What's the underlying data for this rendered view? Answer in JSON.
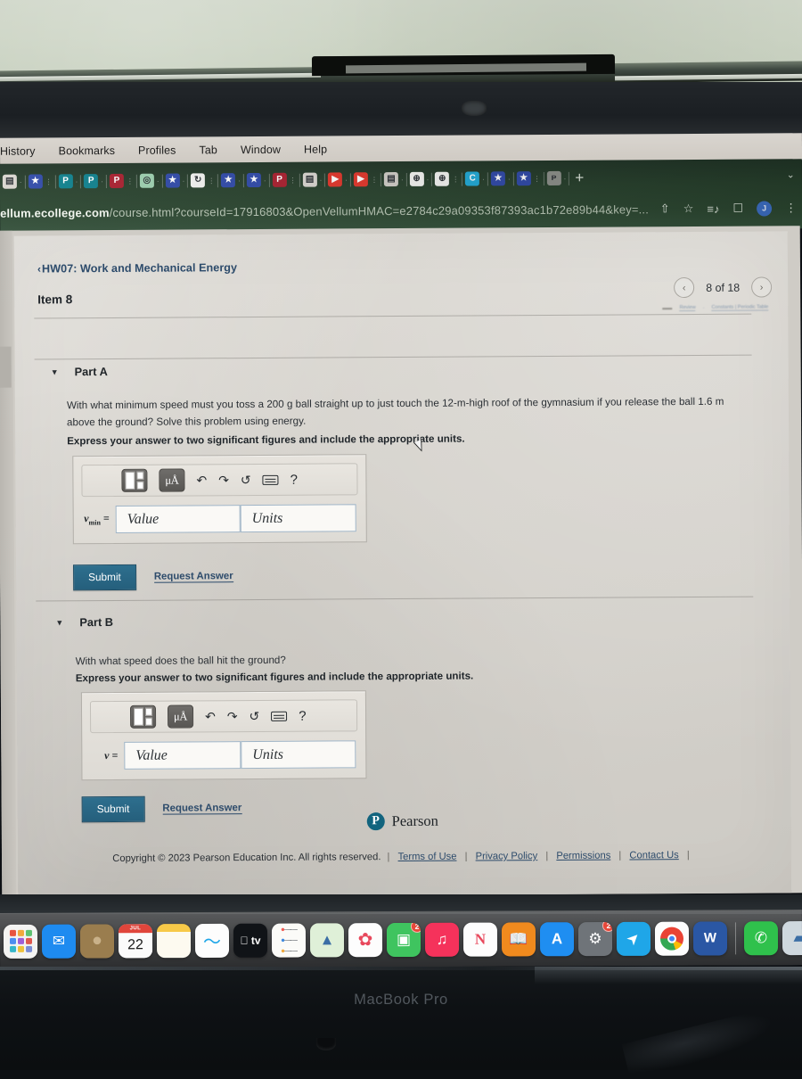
{
  "photo": {
    "device_label": "MacBook Pro"
  },
  "menubar": {
    "items": [
      "History",
      "Bookmarks",
      "Profiles",
      "Tab",
      "Window",
      "Help"
    ]
  },
  "browser": {
    "url_bold": "ellum.ecollege.com",
    "url_rest": "/course.html?courseId=17916803&OpenVellumHMAC=e2784c29a09353f87393ac1b72e89b44&key=...",
    "new_tab_label": "+",
    "tab_list_chevron": "⌄",
    "omnibox_icons": [
      "share-icon",
      "bookmark-star-icon",
      "reading-list-icon",
      "side-panel-icon"
    ],
    "profile_initial": "J",
    "menu_dots": "⋮",
    "tabs": [
      {
        "favicon": "book-icon",
        "color": "#d8d5cf",
        "glyph": "▤"
      },
      {
        "favicon": "star-icon",
        "color": "#2f49a8",
        "glyph": "★"
      },
      {
        "favicon": "pearson-icon",
        "color": "#0d7f8c",
        "glyph": "P"
      },
      {
        "favicon": "pearson-icon",
        "color": "#0d7f8c",
        "glyph": "P"
      },
      {
        "favicon": "pinterest-icon",
        "color": "#a81f2e",
        "glyph": "P"
      },
      {
        "favicon": "mint-app-icon",
        "color": "#9ccfae",
        "glyph": "◎"
      },
      {
        "favicon": "star-icon",
        "color": "#2f49a8",
        "glyph": "★"
      },
      {
        "favicon": "refresh-app-icon",
        "color": "#f2f2f0",
        "glyph": "↻"
      },
      {
        "favicon": "star-icon",
        "color": "#2f49a8",
        "glyph": "★"
      },
      {
        "favicon": "star-icon",
        "color": "#2f49a8",
        "glyph": "★"
      },
      {
        "favicon": "pinterest-icon",
        "color": "#a81f2e",
        "glyph": "P"
      },
      {
        "favicon": "book-icon",
        "color": "#d8d5cf",
        "glyph": "▤"
      },
      {
        "favicon": "youtube-icon",
        "color": "#e1352a",
        "glyph": "▶"
      },
      {
        "favicon": "youtube-icon",
        "color": "#e1352a",
        "glyph": "▶"
      },
      {
        "favicon": "book-icon",
        "color": "#cfccc6",
        "glyph": "▤"
      },
      {
        "favicon": "globe-icon",
        "color": "#f3f3f1",
        "glyph": "⊕"
      },
      {
        "favicon": "globe-icon",
        "color": "#f3f3f1",
        "glyph": "⊕"
      },
      {
        "favicon": "chegg-icon",
        "color": "#1fa9d6",
        "glyph": "C"
      },
      {
        "favicon": "star-icon",
        "color": "#2f49a8",
        "glyph": "★"
      },
      {
        "favicon": "star-icon",
        "color": "#2f49a8",
        "glyph": "★"
      },
      {
        "favicon": "apple-icon",
        "color": "#8c8f8a",
        "glyph": "ᴘ"
      }
    ]
  },
  "page": {
    "breadcrumb": "HW07: Work and Mechanical Energy",
    "breadcrumb_caret": "‹",
    "item_title": "Item 8",
    "pager": {
      "prev": "‹",
      "next": "›",
      "label": "8 of 18"
    },
    "mini_links": [
      "Review",
      "Constants | Periodic Table"
    ],
    "parts": [
      {
        "toggle": "▼",
        "label": "Part A",
        "question": "With what minimum speed must you toss a 200 g ball straight up to just touch the 12-m-high roof of the gymnasium if you release the ball 1.6 m above the ground? Solve this problem using energy.",
        "instruction": "Express your answer to two significant figures and include the appropriate units.",
        "answer": {
          "variable": "v",
          "subscript": "min",
          "equals": "=",
          "value_placeholder": "Value",
          "units_placeholder": "Units",
          "value": "",
          "units": ""
        },
        "toolbar": [
          {
            "name": "math-template-button",
            "label": ""
          },
          {
            "name": "units-button",
            "label": "μÅ"
          },
          {
            "name": "undo-icon",
            "label": "↶"
          },
          {
            "name": "redo-icon",
            "label": "↷"
          },
          {
            "name": "reset-icon",
            "label": "↺"
          },
          {
            "name": "keyboard-icon",
            "label": ""
          },
          {
            "name": "help-icon",
            "label": "?"
          }
        ],
        "submit_label": "Submit",
        "request_answer_label": "Request Answer"
      },
      {
        "toggle": "▼",
        "label": "Part B",
        "question": "With what speed does the ball hit the ground?",
        "instruction": "Express your answer to two significant figures and include the appropriate units.",
        "answer": {
          "variable": "v",
          "subscript": "",
          "equals": "=",
          "value_placeholder": "Value",
          "units_placeholder": "Units",
          "value": "",
          "units": ""
        },
        "submit_label": "Submit",
        "request_answer_label": "Request Answer"
      }
    ],
    "footer": {
      "logo_letter": "P",
      "brand": "Pearson",
      "copyright": "Copyright © 2023 Pearson Education Inc. All rights reserved.",
      "links": [
        "Terms of Use",
        "Privacy Policy",
        "Permissions",
        "Contact Us"
      ],
      "separator": "|"
    },
    "colors": {
      "link": "#2d4b6b",
      "submit_bg": "#2e6f8e",
      "field_border": "#9fb4c6",
      "pearson_blue": "#12647e"
    }
  },
  "dock": {
    "items": [
      {
        "name": "launchpad",
        "kind": "launchpad",
        "bg": "#f4f4f2",
        "running": false
      },
      {
        "name": "mail",
        "kind": "glyph",
        "glyph": "✉",
        "bg": "#1e8bf0",
        "running": false
      },
      {
        "name": "contacts",
        "kind": "glyph",
        "glyph": "●",
        "bg": "#9a7d4e",
        "running": false
      },
      {
        "name": "calendar",
        "kind": "calendar",
        "month": "JUL",
        "day": "22",
        "bg": "#fbfbfb",
        "running": false
      },
      {
        "name": "notes",
        "kind": "notes",
        "bg": "#fbf6e3",
        "running": false
      },
      {
        "name": "freeform",
        "kind": "glyph",
        "glyph": "〜",
        "bg": "#fdfdfd",
        "running": false
      },
      {
        "name": "apple-tv",
        "kind": "glyph",
        "glyph": " tv",
        "bg": "#101317",
        "running": false
      },
      {
        "name": "reminders",
        "kind": "reminders",
        "bg": "#fbfbf8",
        "running": false
      },
      {
        "name": "maps",
        "kind": "glyph",
        "glyph": "▲",
        "bg": "#dff0d8",
        "running": false
      },
      {
        "name": "photos",
        "kind": "glyph",
        "glyph": "✿",
        "bg": "#fdfdfd",
        "running": false
      },
      {
        "name": "facetime",
        "kind": "glyph",
        "glyph": "▣",
        "bg": "#3fc45f",
        "badge": "2",
        "running": false
      },
      {
        "name": "music",
        "kind": "glyph",
        "glyph": "♫",
        "bg": "#f5325b",
        "running": true
      },
      {
        "name": "news",
        "kind": "glyph",
        "glyph": "N",
        "bg": "#fdfdfd",
        "running": false
      },
      {
        "name": "books",
        "kind": "glyph",
        "glyph": "📖",
        "bg": "#f08a1e",
        "running": false
      },
      {
        "name": "app-store",
        "kind": "glyph",
        "glyph": "A",
        "bg": "#1f8ef1",
        "running": false
      },
      {
        "name": "system-settings",
        "kind": "glyph",
        "glyph": "⚙",
        "bg": "#6f7479",
        "badge": "2",
        "running": true
      },
      {
        "name": "safari",
        "kind": "glyph",
        "glyph": "➤",
        "bg": "#1fa6e8",
        "running": true
      },
      {
        "name": "chrome",
        "kind": "chrome",
        "bg": "#fdfdfd",
        "running": true
      },
      {
        "name": "microsoft-word",
        "kind": "glyph",
        "glyph": "W",
        "bg": "#2a57a4",
        "running": true
      },
      {
        "name": "separator",
        "kind": "sep"
      },
      {
        "name": "whatsapp",
        "kind": "glyph",
        "glyph": "✆",
        "bg": "#2fc14c",
        "running": true
      },
      {
        "name": "preview",
        "kind": "glyph",
        "glyph": "▰",
        "bg": "#cfd8de",
        "running": false
      }
    ]
  }
}
